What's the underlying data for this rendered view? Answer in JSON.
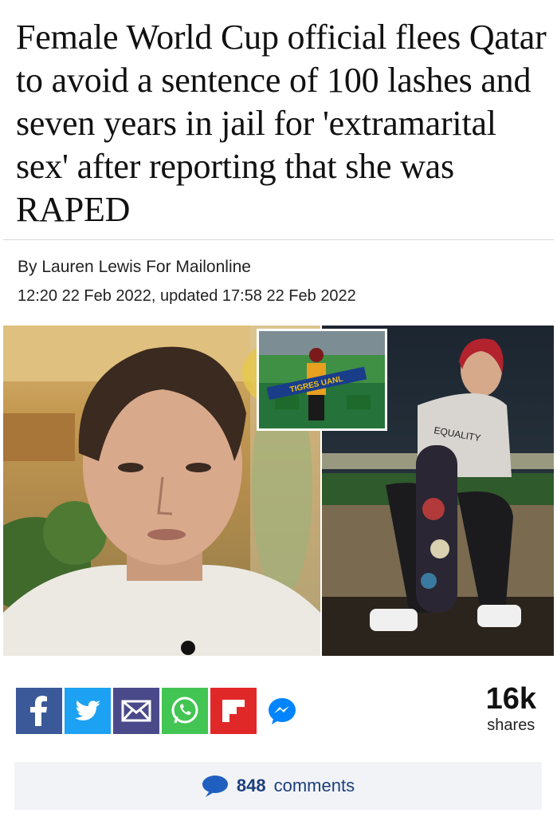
{
  "article": {
    "headline": "Female World Cup official flees Qatar to avoid a sentence of 100 lashes and seven years in jail for 'extramarital sex' after reporting that she was RAPED",
    "byline": "By Lauren Lewis For Mailonline",
    "dateline": "12:20 22 Feb 2022, updated 17:58 22 Feb 2022"
  },
  "photos": {
    "inset_banner_text": "TIGRES UANL",
    "shirt_text": "EQUALITY"
  },
  "share": {
    "buttons": [
      {
        "name": "facebook",
        "icon": "facebook-icon",
        "color": "#3b5998"
      },
      {
        "name": "twitter",
        "icon": "twitter-icon",
        "color": "#1da1f2"
      },
      {
        "name": "email",
        "icon": "email-icon",
        "color": "#4a4a8a"
      },
      {
        "name": "whatsapp",
        "icon": "whatsapp-icon",
        "color": "#43c553"
      },
      {
        "name": "flipboard",
        "icon": "flipboard-icon",
        "color": "#e12828"
      },
      {
        "name": "messenger",
        "icon": "messenger-icon",
        "color": "#0084ff"
      }
    ],
    "count": "16k",
    "label": "shares"
  },
  "comments": {
    "count": "848",
    "label": "comments",
    "accent_color": "#1d3f7c"
  }
}
